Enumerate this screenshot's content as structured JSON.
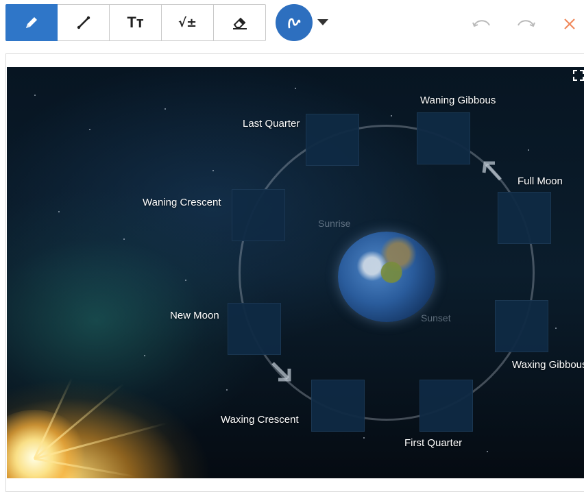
{
  "toolbar": {
    "tools": [
      {
        "name": "pencil-tool",
        "icon": "pencil-icon",
        "active": true
      },
      {
        "name": "line-tool",
        "icon": "line-icon",
        "active": false
      },
      {
        "name": "text-tool",
        "icon": "text-size-icon",
        "active": false
      },
      {
        "name": "math-tool",
        "icon": "math-symbol-icon",
        "active": false
      },
      {
        "name": "eraser-tool",
        "icon": "eraser-icon",
        "active": false
      }
    ],
    "text_tool_glyph": "Tт",
    "math_tool_glyph": "√±",
    "shape_tool_icon": "freehand-curve-icon",
    "dropdown_icon": "caret-down-icon",
    "undo_icon": "undo-icon",
    "redo_icon": "redo-icon",
    "close_icon": "close-icon",
    "colors": {
      "active": "#2f76c8",
      "shape": "#2d6fbf",
      "close": "#f08a5d",
      "muted": "#b9b9b9"
    }
  },
  "diagram": {
    "labels": {
      "waning_gibbous": "Waning Gibbous",
      "last_quarter": "Last Quarter",
      "full_moon": "Full Moon",
      "waning_crescent": "Waning Crescent",
      "new_moon": "New Moon",
      "waxing_gibbous": "Waxing Gibbous",
      "waxing_crescent": "Waxing Crescent",
      "first_quarter": "First Quarter",
      "sunrise": "Sunrise",
      "sunset": "Sunset"
    },
    "fullscreen_icon": "fullscreen-icon"
  }
}
